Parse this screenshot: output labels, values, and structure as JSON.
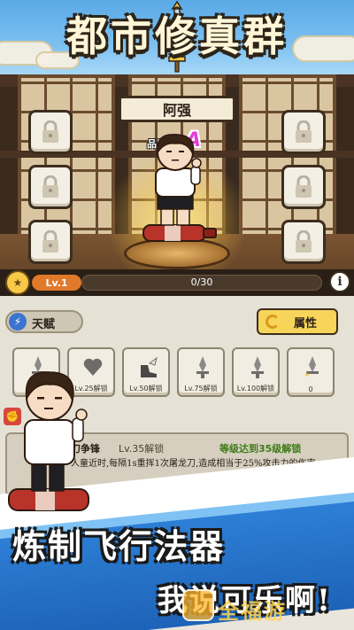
{
  "banner": {
    "title": "都市修真群"
  },
  "character": {
    "name": "阿强",
    "quality_label": "品质:",
    "quality_value": "A"
  },
  "level": {
    "label": "Lv.1",
    "xp_text": "0/30",
    "xp_fraction": 0
  },
  "tabs": {
    "talent": "天赋",
    "attributes": "属性"
  },
  "skills": [
    {
      "caption": "",
      "icon": "sword-icon"
    },
    {
      "caption": "Lv.25解锁",
      "icon": "heart-icon"
    },
    {
      "caption": "Lv.50解锁",
      "icon": "winged-boot-icon"
    },
    {
      "caption": "Lv.75解锁",
      "icon": "sword-icon"
    },
    {
      "caption": "Lv.100解锁",
      "icon": "sword-icon"
    },
    {
      "caption": "0",
      "icon": "star-sword-icon"
    }
  ],
  "detail": {
    "name": "刀争锋",
    "level_req": "Lv.35解锁",
    "unlock_hint": "等级达到35级解锁",
    "description": "人童近时,每隔1s重挥1次屠龙刀,造成相当于25%攻击力的伤害"
  },
  "promo": {
    "headline": "炼制飞行法器",
    "subline": "我说可乐啊!",
    "watermark": "全福游"
  },
  "colors": {
    "accent": "#f6d55a",
    "quality": "#e23fd8",
    "ribbon": "#2d7fd6",
    "xp": "#ef9b3a"
  }
}
